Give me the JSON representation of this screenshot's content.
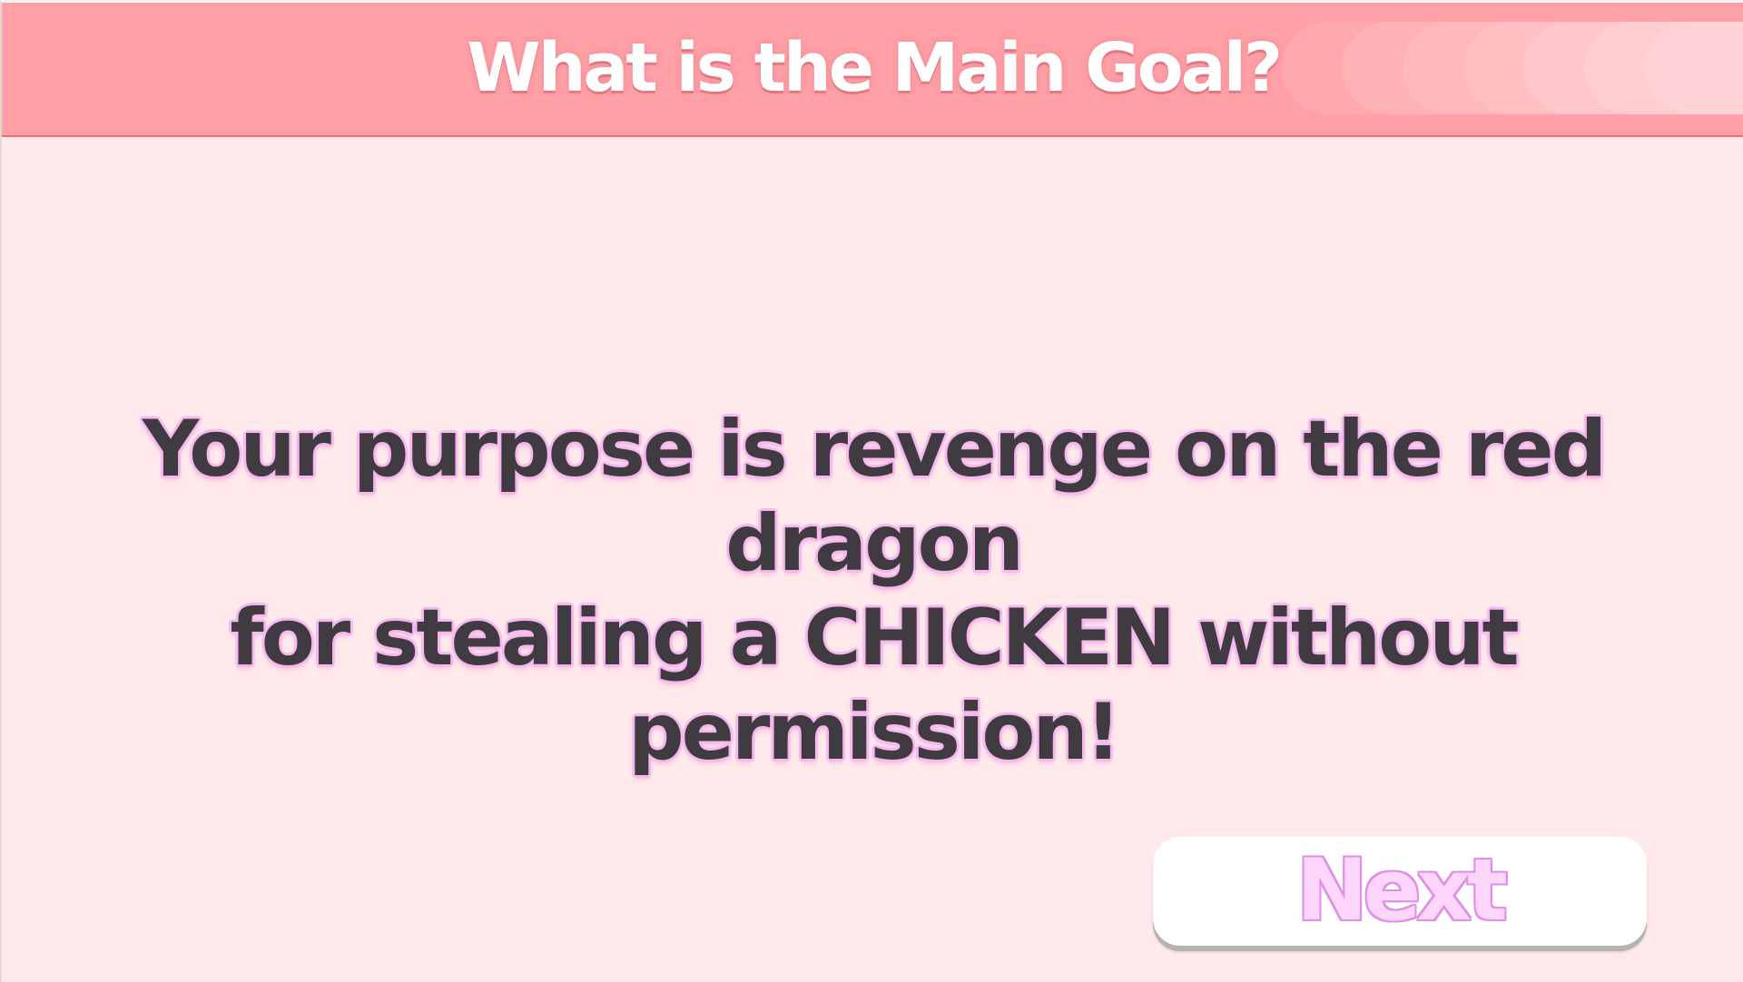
{
  "header": {
    "title": "What is the Main Goal?"
  },
  "main": {
    "message_lines": [
      "Your purpose is revenge on the red dragon",
      "for stealing a CHICKEN without permission!"
    ]
  },
  "controls": {
    "next_label": "Next"
  },
  "colors": {
    "background": "#ffe9ea",
    "header": "#ff9fa6",
    "header_border": "#ef6f78",
    "title_text": "#ffffff",
    "message_text": "#3f3b40",
    "message_outline": "#f7b8ef",
    "button_fill": "#ffffff",
    "button_label": "#ffd6fb",
    "button_label_outline": "#e08ee8"
  }
}
